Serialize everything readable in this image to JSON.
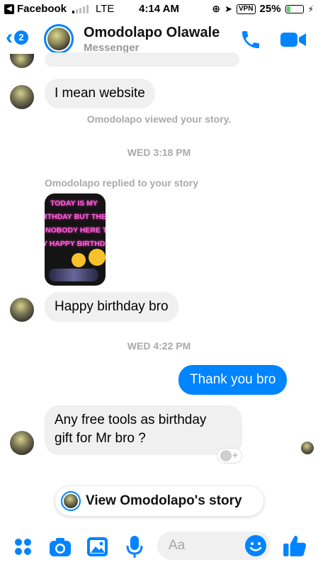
{
  "status_bar": {
    "back_app": "Facebook",
    "carrier": "LTE",
    "time": "4:14 AM",
    "vpn": "VPN",
    "battery": "25%",
    "battery_level": 0.25
  },
  "header": {
    "back_badge": "2",
    "contact_name": "Omodolapo Olawale",
    "subtitle": "Messenger"
  },
  "messages": {
    "m1": "I mean website",
    "viewed_story": "Omodolapo viewed your story.",
    "date1": "WED 3:18 PM",
    "replied_story": "Omodolapo replied to your story",
    "story_lines": [
      "TODAY IS MY",
      "RTHDAY BUT THER",
      "NOBODY HERE TO",
      "Y HAPPY BIRTHDA"
    ],
    "m2": "Happy birthday bro",
    "date2": "WED 4:22 PM",
    "m3": "Thank you bro",
    "m4_line1": "Any free tools as birthday",
    "m4_line2": "gift for Mr bro ?"
  },
  "story_prompt": "View Omodolapo's story",
  "composer": {
    "placeholder": "Aa"
  },
  "colors": {
    "accent": "#0084ff",
    "incoming_bubble": "#f0f0f0"
  },
  "icons": [
    "apps-icon",
    "camera-icon",
    "gallery-icon",
    "microphone-icon",
    "emoji-icon",
    "thumbs-up-icon",
    "phone-icon",
    "video-icon"
  ]
}
